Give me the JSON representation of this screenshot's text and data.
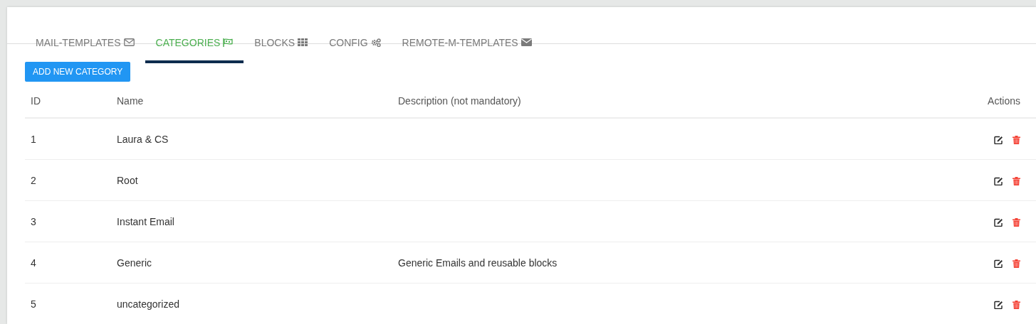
{
  "tabs": [
    {
      "label": "MAIL-TEMPLATES",
      "selected": false
    },
    {
      "label": "CATEGORIES",
      "selected": true
    },
    {
      "label": "BLOCKS",
      "selected": false
    },
    {
      "label": "CONFIG",
      "selected": false
    },
    {
      "label": "REMOTE-M-TEMPLATES",
      "selected": false
    }
  ],
  "add_button": "ADD NEW CATEGORY",
  "table": {
    "columns": [
      "ID",
      "Name",
      "Description (not mandatory)",
      "Actions"
    ],
    "rows": [
      {
        "id": "1",
        "name": "Laura & CS"
      },
      {
        "id": "2",
        "name": "Root"
      },
      {
        "id": "3",
        "name": "Instant Email"
      },
      {
        "id": "4",
        "name": "Generic",
        "description": "Generic Emails and reusable blocks"
      },
      {
        "id": "5",
        "name": "uncategorized"
      }
    ]
  }
}
